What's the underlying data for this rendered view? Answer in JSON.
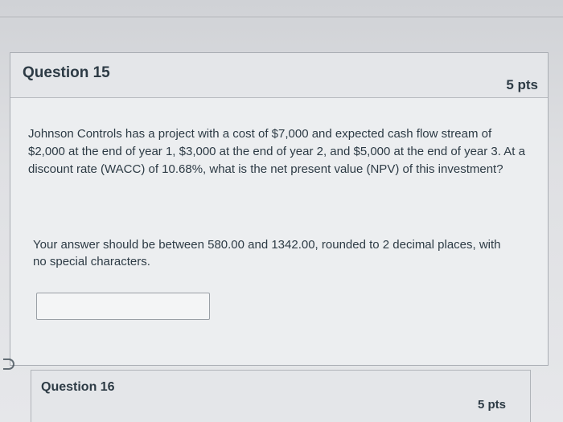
{
  "question": {
    "title": "Question 15",
    "points": "5 pts",
    "body": "Johnson Controls has a project with a cost of $7,000 and expected cash flow stream of $2,000 at the end of year 1, $3,000 at the end of year 2, and $5,000 at the end of year 3. At a discount rate (WACC) of 10.68%, what is the net present value (NPV) of this investment?",
    "instructions": "Your answer should be between 580.00 and 1342.00, rounded to 2 decimal places, with no special characters.",
    "answer_value": "",
    "answer_placeholder": ""
  },
  "next_question": {
    "title": "Question 16",
    "points": "5 pts"
  },
  "colors": {
    "text": "#2d3b45",
    "border": "#a9adb3",
    "header_bg": "#e4e6e9"
  }
}
